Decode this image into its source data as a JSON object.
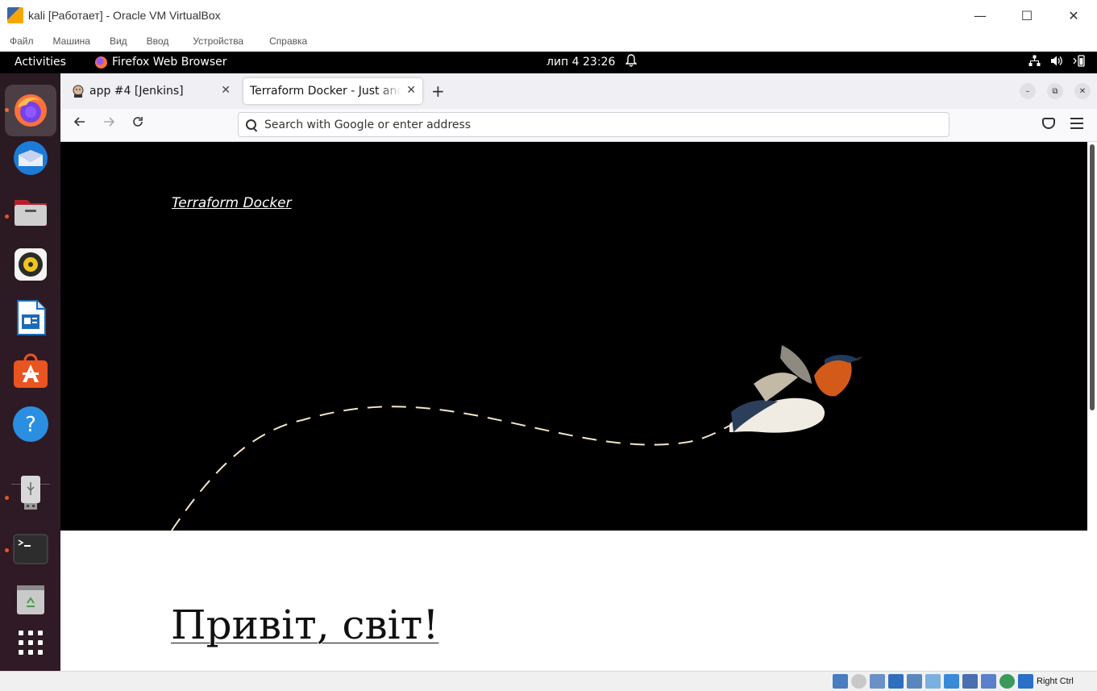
{
  "vbox": {
    "title": "kali [Работает] - Oracle VM VirtualBox",
    "menu": [
      "Файл",
      "Машина",
      "Вид",
      "Ввод",
      "Устройства",
      "Справка"
    ],
    "host_key": "Right Ctrl",
    "window_controls": {
      "minimize": "—",
      "maximize": "☐",
      "close": "✕"
    }
  },
  "topbar": {
    "activities": "Activities",
    "app_name": "Firefox Web Browser",
    "clock": "лип 4  23:26"
  },
  "dock": {
    "items": [
      "firefox-icon",
      "thunderbird-icon",
      "files-icon",
      "rhythmbox-icon",
      "libreoffice-writer-icon",
      "app-center-icon",
      "help-icon",
      "usb-drive-icon",
      "terminal-icon",
      "trash-icon",
      "show-apps-icon"
    ]
  },
  "firefox": {
    "tabs": [
      {
        "label": "app #4 [Jenkins]",
        "icon": "jenkins-icon"
      },
      {
        "label": "Terraform Docker - Just another",
        "icon": "none"
      }
    ],
    "urlbar": {
      "placeholder": "Search with Google or enter address",
      "value": ""
    }
  },
  "page": {
    "site_title": "Terraform Docker",
    "post_title": "Привіт, світ!"
  },
  "colors": {
    "hero_bg": "#000000",
    "dock_bg": "#2c1a24",
    "accent": "#e95420"
  }
}
